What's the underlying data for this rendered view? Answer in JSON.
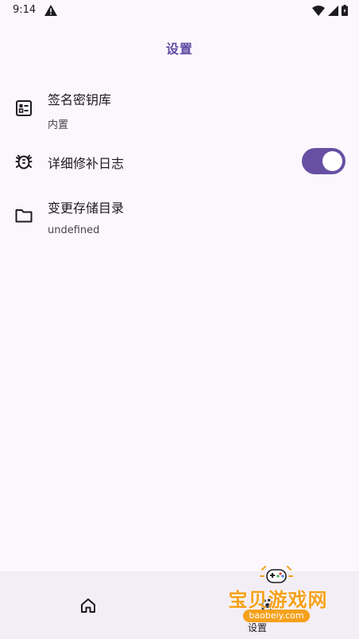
{
  "status_bar": {
    "time": "9:14",
    "warning_icon": "warning-icon",
    "wifi_icon": "wifi-icon",
    "signal_icon": "signal-icon",
    "battery_icon": "battery-icon"
  },
  "header": {
    "title": "设置"
  },
  "settings": {
    "items": [
      {
        "icon": "signing-key-icon",
        "title": "签名密钥库",
        "subtitle": "内置"
      },
      {
        "icon": "bug-icon",
        "title": "详细修补日志",
        "toggle_on": true
      },
      {
        "icon": "folder-icon",
        "title": "变更存储目录",
        "subtitle": "undefined"
      }
    ]
  },
  "bottom_nav": {
    "home": {
      "icon": "home-icon",
      "label": ""
    },
    "settings": {
      "icon": "settings-icon",
      "label": "设置"
    }
  },
  "watermark": {
    "text": "宝贝游戏网",
    "url": "baobeiy.com"
  },
  "colors": {
    "background": "#fcf7fd",
    "accent": "#6750a4",
    "title": "#5e4aa2",
    "nav_background": "#f3eef5",
    "watermark": "#f5a11c"
  }
}
